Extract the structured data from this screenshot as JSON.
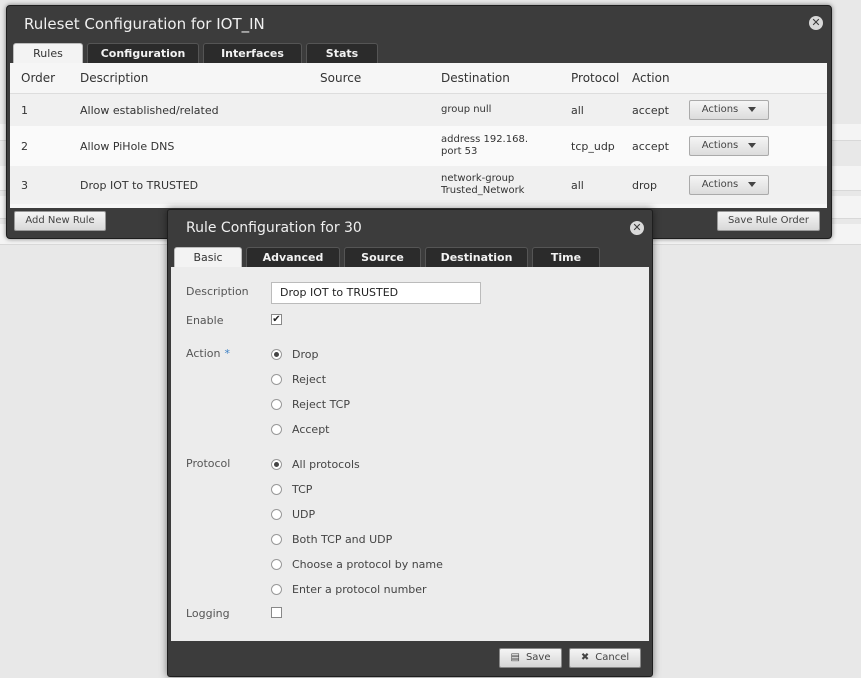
{
  "ruleset": {
    "title": "Ruleset Configuration for IOT_IN",
    "close": "✕",
    "tabs": [
      "Rules",
      "Configuration",
      "Interfaces",
      "Stats"
    ],
    "columns": [
      "Order",
      "Description",
      "Source",
      "Destination",
      "Protocol",
      "Action"
    ],
    "rows": [
      {
        "order": "1",
        "description": "Allow established/related",
        "source": "",
        "destination": [
          "group null"
        ],
        "protocol": "all",
        "action": "accept",
        "actions_label": "Actions"
      },
      {
        "order": "2",
        "description": "Allow PiHole DNS",
        "source": "",
        "destination": [
          "address 192.168.",
          "port 53"
        ],
        "protocol": "tcp_udp",
        "action": "accept",
        "actions_label": "Actions"
      },
      {
        "order": "3",
        "description": "Drop IOT to TRUSTED",
        "source": "",
        "destination": [
          "network-group",
          "Trusted_Network"
        ],
        "protocol": "all",
        "action": "drop",
        "actions_label": "Actions"
      }
    ],
    "add_rule": "Add New Rule",
    "save_order": "Save Rule Order"
  },
  "rule_config": {
    "title": "Rule Configuration for 30",
    "close": "✕",
    "tabs": [
      "Basic",
      "Advanced",
      "Source",
      "Destination",
      "Time"
    ],
    "description_label": "Description",
    "description_value": "Drop IOT to TRUSTED",
    "enable_label": "Enable",
    "enable_checked": true,
    "check_mark": "✔",
    "action_label": "Action",
    "required_mark": "*",
    "actions": [
      "Drop",
      "Reject",
      "Reject TCP",
      "Accept"
    ],
    "selected_action": "Drop",
    "protocol_label": "Protocol",
    "protocols": [
      "All protocols",
      "TCP",
      "UDP",
      "Both TCP and UDP",
      "Choose a protocol by name",
      "Enter a protocol number"
    ],
    "selected_protocol": "All protocols",
    "logging_label": "Logging",
    "logging_checked": false,
    "save": "Save",
    "cancel": "Cancel",
    "save_icon": "save-icon",
    "cancel_icon": "cancel-icon"
  }
}
